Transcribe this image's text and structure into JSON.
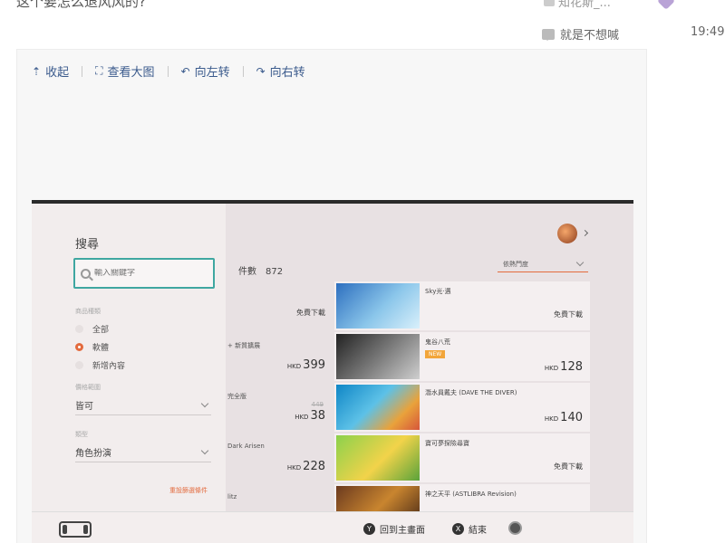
{
  "post": {
    "cut_title": "这个要怎么退风风的?",
    "cut_user": "知花斯_..."
  },
  "reply": {
    "author": "就是不想喊",
    "time": "19:49"
  },
  "toolbar": {
    "collapse": "收起",
    "view_large": "查看大图",
    "rotate_left": "向左转",
    "rotate_right": "向右转"
  },
  "eshop": {
    "search_title": "搜尋",
    "search_placeholder": "輸入關鍵字",
    "section_caption": "商品種類",
    "radio_all": "全部",
    "radio_software": "軟體",
    "radio_new": "新增內容",
    "price_caption": "價格範圍",
    "price_value": "皆可",
    "genre_caption": "類型",
    "genre_value": "角色扮演",
    "reset_label": "重設篩選條件",
    "count_label": "件數",
    "count_value": "872",
    "sort_label": "依熱門度",
    "left_rows": [
      {
        "tag": "",
        "price_currency": "",
        "price": "",
        "free": "免費下載"
      },
      {
        "tag": "+ 新質擴展",
        "price_currency": "HKD",
        "price": "399",
        "free": ""
      },
      {
        "tag": "完全版",
        "price_currency": "HKD",
        "price": "38",
        "strike": "449",
        "free": ""
      },
      {
        "tag": "Dark Arisen",
        "price_currency": "HKD",
        "price": "228",
        "free": ""
      },
      {
        "tag": "litz",
        "price_currency": "",
        "price": "",
        "free": ""
      }
    ],
    "right_rows": [
      {
        "name": "Sky光·遇",
        "badge": "",
        "price_currency": "",
        "price": "",
        "free": "免費下載"
      },
      {
        "name": "鬼谷八荒",
        "badge": "NEW",
        "price_currency": "HKD",
        "price": "128",
        "free": ""
      },
      {
        "name": "潛水員戴夫 (DAVE THE DIVER)",
        "badge": "",
        "price_currency": "HKD",
        "price": "140",
        "free": ""
      },
      {
        "name": "寶可夢探險尋寶",
        "badge": "",
        "price_currency": "",
        "price": "",
        "free": "免費下載"
      },
      {
        "name": "神之天平 (ASTLIBRA Revision)",
        "badge": "",
        "price_currency": "",
        "price": "",
        "free": ""
      }
    ],
    "hint_home_key": "Y",
    "hint_home": "回到主畫面",
    "hint_end_key": "X",
    "hint_end": "結束"
  }
}
